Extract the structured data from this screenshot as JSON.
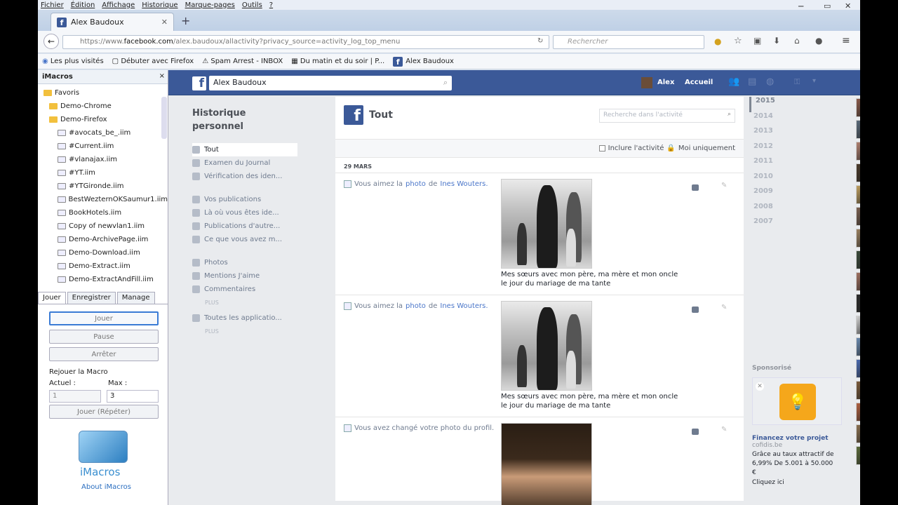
{
  "menu": [
    "Fichier",
    "Édition",
    "Affichage",
    "Historique",
    "Marque-pages",
    "Outils",
    "?"
  ],
  "tab": {
    "title": "Alex Baudoux",
    "new_tab": "+"
  },
  "nav": {
    "url_prefix": "https://www.",
    "url_domain": "facebook.com",
    "url_path": "/alex.baudoux/allactivity?privacy_source=activity_log_top_menu",
    "search_placeholder": "Rechercher"
  },
  "bookmarks": [
    "Les plus visités",
    "Débuter avec Firefox",
    "Spam Arrest - INBOX",
    "Du matin et du soir | P...",
    "Alex Baudoux"
  ],
  "imacros": {
    "title": "iMacros",
    "close": "×",
    "tree": [
      {
        "label": "Favoris",
        "type": "root"
      },
      {
        "label": "Demo-Chrome",
        "type": "folder"
      },
      {
        "label": "Demo-Firefox",
        "type": "folder"
      },
      {
        "label": "#avocats_be_.iim",
        "type": "file"
      },
      {
        "label": "#Current.iim",
        "type": "file"
      },
      {
        "label": "#vlanajax.iim",
        "type": "file"
      },
      {
        "label": "#YT.iim",
        "type": "file"
      },
      {
        "label": "#YTGironde.iim",
        "type": "file"
      },
      {
        "label": "BestWezternOKSaumur1.iim",
        "type": "file"
      },
      {
        "label": "BookHotels.iim",
        "type": "file"
      },
      {
        "label": "Copy of newvlan1.iim",
        "type": "file"
      },
      {
        "label": "Demo-ArchivePage.iim",
        "type": "file"
      },
      {
        "label": "Demo-Download.iim",
        "type": "file"
      },
      {
        "label": "Demo-Extract.iim",
        "type": "file"
      },
      {
        "label": "Demo-ExtractAndFill.iim",
        "type": "file"
      }
    ],
    "tabs": [
      "Jouer",
      "Enregistrer",
      "Manage"
    ],
    "btn_play": "Jouer",
    "btn_pause": "Pause",
    "btn_stop": "Arrêter",
    "replay_label": "Rejouer la Macro",
    "current_label": "Actuel :",
    "max_label": "Max :",
    "current_value": "1",
    "max_value": "3",
    "btn_loop": "Jouer (Répéter)",
    "logo_text": "iMacros",
    "about": "About iMacros"
  },
  "fb": {
    "search_value": "Alex Baudoux",
    "user": "Alex",
    "home": "Accueil",
    "left_title": "Historique personnel",
    "nav1": [
      "Tout",
      "Examen du Journal",
      "Vérification des iden..."
    ],
    "nav2": [
      "Vos publications",
      "Là où vous êtes ide...",
      "Publications d'autre...",
      "Ce que vous avez m..."
    ],
    "nav3": [
      "Photos",
      "Mentions J'aime",
      "Commentaires"
    ],
    "plus": "PLUS",
    "nav4": [
      "Toutes les applicatio..."
    ],
    "main_title": "Tout",
    "activity_search": "Recherche dans l'activité",
    "include_label": "Inclure l'activité",
    "only_me": "Moi uniquement",
    "date": "29 MARS",
    "entries": [
      {
        "pre": "Vous aimez la",
        "link1": "photo",
        "mid": "de",
        "link2": "Ines Wouters.",
        "caption": "Mes sœurs avec mon père, ma mère et mon oncle le jour du mariage de ma tante"
      },
      {
        "pre": "Vous aimez la",
        "link1": "photo",
        "mid": "de",
        "link2": "Ines Wouters.",
        "caption": "Mes sœurs avec mon père, ma mère et mon oncle le jour du mariage de ma tante"
      },
      {
        "pre": "Vous avez changé votre photo du profil.",
        "link1": "",
        "mid": "",
        "link2": "",
        "caption": ""
      }
    ],
    "years": [
      "2015",
      "2014",
      "2013",
      "2012",
      "2011",
      "2010",
      "2009",
      "2008",
      "2007"
    ],
    "sponsored": "Sponsorisé",
    "ad_title": "Financez votre projet",
    "ad_domain": "cofidis.be",
    "ad_body": "Grâce au taux attractif de 6,99% De 5.001 à 50.000 €",
    "ad_cta": "Cliquez ici",
    "colors": {
      "fb_blue": "#3b5998",
      "link": "#4a76c9",
      "online": "#42b72a"
    }
  }
}
